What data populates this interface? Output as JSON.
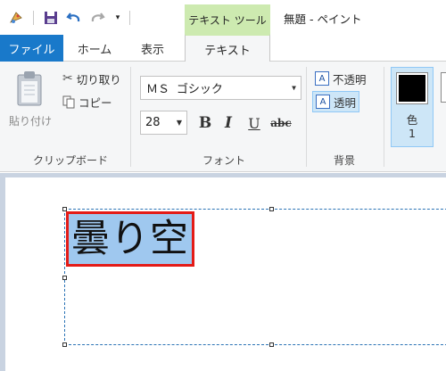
{
  "window": {
    "title": "無題 - ペイント",
    "context_tab_group": "テキスト ツール"
  },
  "quick_access": {
    "icons": [
      "paint-app-icon",
      "save-icon",
      "undo-icon",
      "redo-icon",
      "customize-dropdown-icon"
    ]
  },
  "tabs": {
    "file": "ファイル",
    "home": "ホーム",
    "view": "表示",
    "text": "テキスト"
  },
  "clipboard": {
    "paste": "貼り付け",
    "cut": "切り取り",
    "copy": "コピー",
    "group_label": "クリップボード"
  },
  "font": {
    "family": "ＭＳ ゴシック",
    "size": "28",
    "bold": "B",
    "italic": "I",
    "underline": "U",
    "strikethrough": "abc",
    "group_label": "フォント"
  },
  "background": {
    "opaque": "不透明",
    "transparent": "透明",
    "selected": "transparent",
    "group_label": "背景"
  },
  "colors": {
    "color1_label": "色",
    "color1_number": "1",
    "color1_value": "#000000",
    "accent": "#1979ca",
    "selection_highlight": "#9fc8ef",
    "annotation_box": "#e41b17"
  },
  "canvas": {
    "text": "曇り空"
  }
}
